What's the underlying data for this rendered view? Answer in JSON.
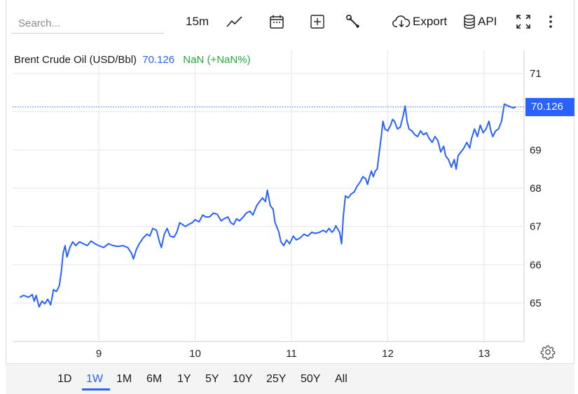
{
  "toolbar": {
    "search_placeholder": "Search...",
    "interval": "15m",
    "export_label": "Export",
    "api_label": "API",
    "icons": [
      "line-chart-icon",
      "calendar-icon",
      "add-indicator-icon",
      "wrench-icon",
      "cloud-download-icon",
      "database-icon",
      "fullscreen-icon",
      "more-vertical-icon"
    ]
  },
  "legend": {
    "name": "Brent Crude Oil (USD/Bbl)",
    "last": "70.126",
    "change": "NaN (+NaN%)"
  },
  "price_tag": "70.126",
  "ranges": [
    "1D",
    "1W",
    "1M",
    "6M",
    "1Y",
    "5Y",
    "10Y",
    "25Y",
    "50Y",
    "All"
  ],
  "active_range": "1W",
  "colors": {
    "line": "#2962ff",
    "change": "#22ab3b",
    "grid": "#e6e6e6",
    "last_line": "#2962ff"
  },
  "chart_data": {
    "type": "line",
    "title": "Brent Crude Oil (USD/Bbl)",
    "ylim": [
      64,
      72
    ],
    "yticks": [
      65,
      66,
      67,
      68,
      69,
      70,
      71
    ],
    "xticks": [
      {
        "x": 9,
        "label": "9"
      },
      {
        "x": 10,
        "label": "10"
      },
      {
        "x": 11,
        "label": "11"
      },
      {
        "x": 12,
        "label": "12"
      },
      {
        "x": 13,
        "label": "13"
      }
    ],
    "xlim": [
      8.17,
      13.35
    ],
    "last_value": 70.126,
    "grid": true,
    "series": [
      {
        "name": "",
        "points": [
          [
            8.18,
            65.15
          ],
          [
            8.22,
            65.2
          ],
          [
            8.27,
            65.15
          ],
          [
            8.31,
            65.22
          ],
          [
            8.33,
            65.05
          ],
          [
            8.35,
            65.2
          ],
          [
            8.38,
            64.9
          ],
          [
            8.41,
            65.05
          ],
          [
            8.44,
            64.98
          ],
          [
            8.47,
            65.1
          ],
          [
            8.5,
            64.95
          ],
          [
            8.53,
            65.35
          ],
          [
            8.56,
            65.3
          ],
          [
            8.59,
            65.45
          ],
          [
            8.61,
            65.8
          ],
          [
            8.63,
            66.3
          ],
          [
            8.65,
            66.5
          ],
          [
            8.67,
            66.2
          ],
          [
            8.7,
            66.45
          ],
          [
            8.73,
            66.6
          ],
          [
            8.76,
            66.5
          ],
          [
            8.8,
            66.6
          ],
          [
            8.84,
            66.55
          ],
          [
            8.88,
            66.5
          ],
          [
            8.92,
            66.62
          ],
          [
            8.96,
            66.55
          ],
          [
            9.0,
            66.5
          ],
          [
            9.05,
            66.45
          ],
          [
            9.1,
            66.55
          ],
          [
            9.15,
            66.5
          ],
          [
            9.2,
            66.48
          ],
          [
            9.25,
            66.5
          ],
          [
            9.3,
            66.45
          ],
          [
            9.34,
            66.3
          ],
          [
            9.36,
            66.15
          ],
          [
            9.39,
            66.4
          ],
          [
            9.42,
            66.55
          ],
          [
            9.46,
            66.7
          ],
          [
            9.5,
            66.8
          ],
          [
            9.53,
            66.75
          ],
          [
            9.56,
            66.95
          ],
          [
            9.6,
            66.9
          ],
          [
            9.63,
            66.6
          ],
          [
            9.65,
            66.45
          ],
          [
            9.68,
            66.8
          ],
          [
            9.71,
            66.95
          ],
          [
            9.74,
            66.75
          ],
          [
            9.78,
            66.72
          ],
          [
            9.81,
            66.85
          ],
          [
            9.84,
            67.1
          ],
          [
            9.87,
            67.05
          ],
          [
            9.9,
            67.0
          ],
          [
            9.93,
            67.05
          ],
          [
            9.97,
            67.1
          ],
          [
            10.0,
            67.18
          ],
          [
            10.04,
            67.12
          ],
          [
            10.08,
            67.3
          ],
          [
            10.11,
            67.25
          ],
          [
            10.15,
            67.25
          ],
          [
            10.19,
            67.35
          ],
          [
            10.23,
            67.32
          ],
          [
            10.27,
            67.15
          ],
          [
            10.3,
            67.2
          ],
          [
            10.34,
            67.25
          ],
          [
            10.37,
            67.1
          ],
          [
            10.4,
            67.05
          ],
          [
            10.43,
            67.2
          ],
          [
            10.46,
            67.15
          ],
          [
            10.5,
            67.25
          ],
          [
            10.53,
            67.35
          ],
          [
            10.57,
            67.4
          ],
          [
            10.6,
            67.3
          ],
          [
            10.64,
            67.55
          ],
          [
            10.67,
            67.65
          ],
          [
            10.7,
            67.75
          ],
          [
            10.73,
            67.65
          ],
          [
            10.75,
            67.95
          ],
          [
            10.78,
            67.55
          ],
          [
            10.81,
            67.45
          ],
          [
            10.83,
            67.1
          ],
          [
            10.85,
            66.98
          ],
          [
            10.87,
            66.85
          ],
          [
            10.89,
            66.6
          ],
          [
            10.92,
            66.5
          ],
          [
            10.95,
            66.65
          ],
          [
            10.98,
            66.55
          ],
          [
            11.02,
            66.75
          ],
          [
            11.05,
            66.65
          ],
          [
            11.09,
            66.7
          ],
          [
            11.13,
            66.8
          ],
          [
            11.17,
            66.75
          ],
          [
            11.21,
            66.85
          ],
          [
            11.25,
            66.82
          ],
          [
            11.29,
            66.85
          ],
          [
            11.33,
            66.9
          ],
          [
            11.36,
            66.85
          ],
          [
            11.39,
            66.95
          ],
          [
            11.42,
            66.85
          ],
          [
            11.44,
            66.9
          ],
          [
            11.46,
            67.02
          ],
          [
            11.5,
            66.85
          ],
          [
            11.52,
            66.55
          ],
          [
            11.54,
            67.3
          ],
          [
            11.56,
            67.8
          ],
          [
            11.59,
            67.75
          ],
          [
            11.62,
            67.85
          ],
          [
            11.65,
            67.9
          ],
          [
            11.68,
            68.05
          ],
          [
            11.71,
            68.15
          ],
          [
            11.74,
            68.3
          ],
          [
            11.77,
            68.25
          ],
          [
            11.79,
            68.1
          ],
          [
            11.81,
            68.3
          ],
          [
            11.83,
            68.45
          ],
          [
            11.85,
            68.3
          ],
          [
            11.87,
            68.45
          ],
          [
            11.89,
            68.5
          ],
          [
            11.91,
            68.9
          ],
          [
            11.93,
            69.3
          ],
          [
            11.95,
            69.75
          ],
          [
            11.97,
            69.55
          ],
          [
            12.0,
            69.5
          ],
          [
            12.03,
            69.65
          ],
          [
            12.05,
            69.8
          ],
          [
            12.07,
            69.75
          ],
          [
            12.1,
            69.55
          ],
          [
            12.13,
            69.6
          ],
          [
            12.16,
            69.9
          ],
          [
            12.18,
            70.15
          ],
          [
            12.2,
            69.75
          ],
          [
            12.22,
            69.55
          ],
          [
            12.25,
            69.5
          ],
          [
            12.28,
            69.4
          ],
          [
            12.31,
            69.35
          ],
          [
            12.34,
            69.5
          ],
          [
            12.37,
            69.4
          ],
          [
            12.4,
            69.45
          ],
          [
            12.43,
            69.3
          ],
          [
            12.46,
            69.2
          ],
          [
            12.49,
            69.35
          ],
          [
            12.52,
            69.25
          ],
          [
            12.55,
            68.95
          ],
          [
            12.58,
            69.1
          ],
          [
            12.6,
            68.85
          ],
          [
            12.63,
            68.75
          ],
          [
            12.66,
            68.55
          ],
          [
            12.69,
            68.75
          ],
          [
            12.71,
            68.5
          ],
          [
            12.73,
            68.85
          ],
          [
            12.76,
            68.95
          ],
          [
            12.79,
            69.05
          ],
          [
            12.82,
            69.2
          ],
          [
            12.85,
            69.05
          ],
          [
            12.87,
            69.3
          ],
          [
            12.9,
            69.55
          ],
          [
            12.93,
            69.35
          ],
          [
            12.96,
            69.65
          ],
          [
            12.99,
            69.45
          ],
          [
            13.02,
            69.55
          ],
          [
            13.05,
            69.75
          ],
          [
            13.07,
            69.5
          ],
          [
            13.09,
            69.35
          ],
          [
            13.12,
            69.5
          ],
          [
            13.15,
            69.55
          ],
          [
            13.18,
            69.75
          ],
          [
            13.21,
            70.2
          ],
          [
            13.25,
            70.15
          ],
          [
            13.3,
            70.1
          ],
          [
            13.33,
            70.126
          ]
        ]
      }
    ]
  }
}
